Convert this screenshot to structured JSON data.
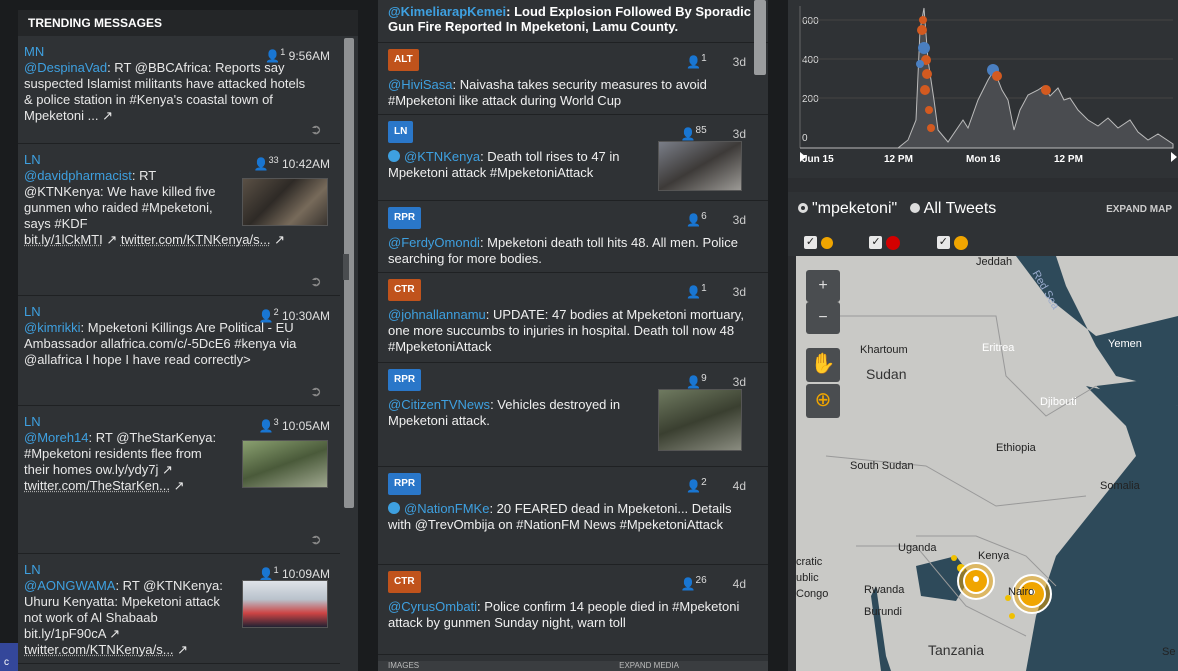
{
  "left_panel": {
    "title": "TRENDING MESSAGES",
    "tweets": [
      {
        "group": "MN",
        "count": "1",
        "time": "9:56AM",
        "author": "@DespinaVad",
        "text": ": RT @BBCAfrica: Reports say suspected Islamist militants have attacked hotels & police station in #Kenya's coastal town of Mpeketoni ..."
      },
      {
        "group": "LN",
        "count": "33",
        "time": "10:42AM",
        "author": "@davidpharmacist",
        "text1": ": RT @KTNKenya: We have killed five gunmen who raided #Mpeketoni, says #KDF",
        "text2": "bit.ly/1lCkMTI",
        "text3": "twitter.com/KTNKenya/s...",
        "has_image": true
      },
      {
        "group": "LN",
        "count": "2",
        "time": "10:30AM",
        "author": "@kimrikki",
        "text": ": Mpeketoni Killings Are Political - EU Ambassador allafrica.com/c/-5DcE6 #kenya via @allafrica I hope I have read correctly>"
      },
      {
        "group": "LN",
        "count": "3",
        "time": "10:05AM",
        "author": "@Moreh14",
        "text": ": RT @TheStarKenya: #Mpeketoni residents flee from their homes ow.ly/ydy7j",
        "text2": "twitter.com/TheStarKen...",
        "has_image": true
      },
      {
        "group": "LN",
        "count": "1",
        "time": "10:09AM",
        "author": "@AONGWAMA",
        "text": ": RT @KTNKenya: Uhuru Kenyatta: Mpeketoni attack not work of Al Shabaab bit.ly/1pF90cA",
        "text2": "twitter.com/KTNKenya/s...",
        "has_image": true
      }
    ]
  },
  "middle_panel": {
    "top_item": {
      "author": "@KimeliarapKemei",
      "text": ": Loud Explosion Followed By Sporadic Gun Fire Reported In Mpeketoni, Lamu County."
    },
    "items": [
      {
        "badge": "ALT",
        "count": "1",
        "age": "3d",
        "author": "@HiviSasa",
        "text": ": Naivasha takes security measures to avoid #Mpeketoni like attack during World Cup"
      },
      {
        "badge": "LN",
        "count": "85",
        "age": "3d",
        "author": "@KTNKenya",
        "text": ": Death toll rises to 47 in Mpeketoni attack #MpeketoniAttack",
        "verified": true,
        "has_image": true
      },
      {
        "badge": "RPR",
        "count": "6",
        "age": "3d",
        "author": "@FerdyOmondi",
        "text": ": Mpeketoni death toll hits 48. All men. Police searching for more bodies."
      },
      {
        "badge": "CTR",
        "count": "1",
        "age": "3d",
        "author": "@johnallannamu",
        "text": ": UPDATE: 47 bodies at Mpeketoni mortuary, one more succumbs to injuries in hospital. Death toll now 48 #MpeketoniAttack"
      },
      {
        "badge": "RPR",
        "count": "9",
        "age": "3d",
        "author": "@CitizenTVNews",
        "text": ": Vehicles destroyed in Mpeketoni attack.",
        "has_image": true
      },
      {
        "badge": "RPR",
        "count": "2",
        "age": "4d",
        "author": "@NationFMKe",
        "text": ": 20 FEARED dead in Mpeketoni... Details with @TrevOmbija on #NationFM News #MpeketoniAttack",
        "verified": true
      },
      {
        "badge": "CTR",
        "count": "26",
        "age": "4d",
        "author": "@CyrusOmbati",
        "text": ": Police confirm 14 people died in #Mpeketoni attack by gunmen Sunday night, warn toll"
      }
    ],
    "footer_left": "IMAGES",
    "footer_right": "EXPAND MEDIA"
  },
  "right_panel": {
    "chart": {
      "ticks_y": [
        "600",
        "400",
        "200",
        "0"
      ],
      "ticks_x": [
        "Jun 15",
        "12 PM",
        "Mon 16",
        "12 PM"
      ]
    },
    "map_header": {
      "option1": "\"mpeketoni\"",
      "option2": "All Tweets",
      "expand": "EXPAND MAP"
    },
    "filter_colors": [
      "#f0a500",
      "#d40000",
      "#f0a500"
    ],
    "map_labels": {
      "jeddah": "Jeddah",
      "red_sea": "Red Sea",
      "khartoum": "Khartoum",
      "sudan": "Sudan",
      "eritrea": "Eritrea",
      "yemen": "Yemen",
      "djibouti": "Djibouti",
      "ethiopia": "Ethiopia",
      "south_sudan": "South Sudan",
      "somalia": "Somalia",
      "uganda": "Uganda",
      "kenya": "Kenya",
      "rwanda": "Rwanda",
      "burundi": "Burundi",
      "tanzania": "Tanzania",
      "nairobi": "Nairo",
      "congo1": "cratic",
      "congo2": "ublic",
      "congo3": "Congo",
      "se": "Se"
    }
  },
  "chart_data": {
    "type": "scatter",
    "x_ticks": [
      "Jun 15",
      "12 PM",
      "Mon 16",
      "12 PM"
    ],
    "y_ticks": [
      0,
      200,
      400,
      600
    ],
    "ylim": [
      0,
      700
    ]
  }
}
